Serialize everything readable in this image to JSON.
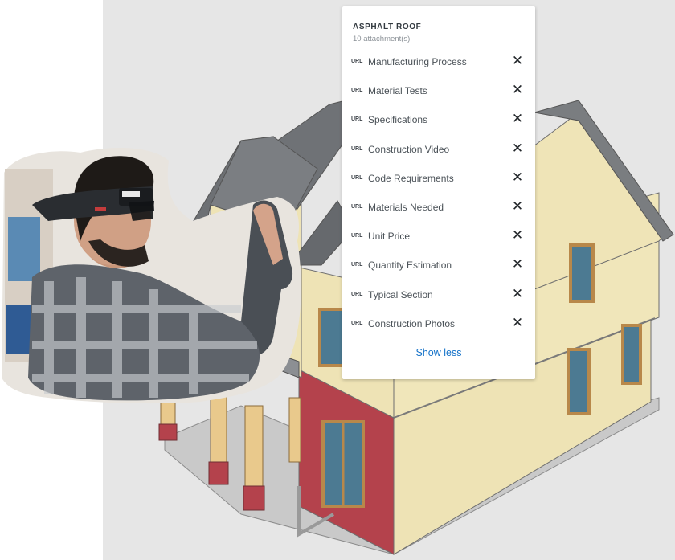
{
  "panel": {
    "title": "ASPHALT ROOF",
    "subtitle": "10 attachment(s)",
    "badge": "URL",
    "items": [
      {
        "label": "Manufacturing Process"
      },
      {
        "label": "Material Tests"
      },
      {
        "label": "Specifications"
      },
      {
        "label": "Construction Video"
      },
      {
        "label": "Code Requirements"
      },
      {
        "label": "Materials Needed"
      },
      {
        "label": "Unit Price"
      },
      {
        "label": "Quantity Estimation"
      },
      {
        "label": "Typical Section"
      },
      {
        "label": "Construction Photos"
      }
    ],
    "close_glyph": "✕",
    "show_less": "Show less"
  },
  "colors": {
    "viewport_bg": "#e6e6e6",
    "roof": "#7a7d80",
    "siding_yellow": "#eee3b5",
    "siding_red": "#b4424c",
    "window_glass": "#4c7a92",
    "window_frame": "#b8884a",
    "link": "#1673c9"
  }
}
